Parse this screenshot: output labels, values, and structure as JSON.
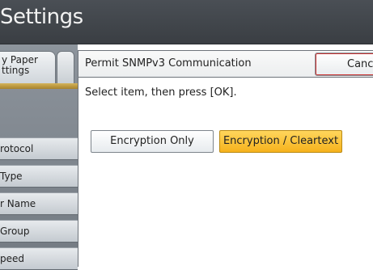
{
  "window": {
    "title": "Settings"
  },
  "left_panel": {
    "tab_label": "y Paper\nttings",
    "items": [
      {
        "label": "rotocol"
      },
      {
        "label": "Type"
      },
      {
        "label": "r Name"
      },
      {
        "label": "Group"
      },
      {
        "label": "peed"
      }
    ]
  },
  "dialog": {
    "title": "Permit SNMPv3 Communication",
    "cancel_label": "Cancel",
    "instruction": "Select item, then press [OK].",
    "options": [
      {
        "label": "Encryption Only",
        "selected": false
      },
      {
        "label": "Encryption / Cleartext",
        "selected": true
      }
    ]
  },
  "colors": {
    "selected_option": "#f8c034",
    "title_bar": "#424950"
  }
}
